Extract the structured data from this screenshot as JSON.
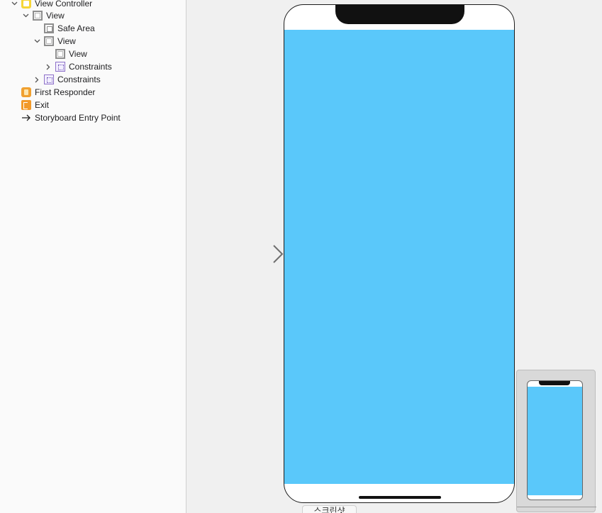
{
  "outline": {
    "items": [
      {
        "label": "View Controller",
        "icon": "view-controller-icon",
        "chevron": "down"
      },
      {
        "label": "View",
        "icon": "view-icon",
        "chevron": "down"
      },
      {
        "label": "Safe Area",
        "icon": "safe-area-icon",
        "chevron": ""
      },
      {
        "label": "View",
        "icon": "view-icon",
        "chevron": "down"
      },
      {
        "label": "View",
        "icon": "view-icon",
        "chevron": ""
      },
      {
        "label": "Constraints",
        "icon": "constraints-icon",
        "chevron": "right"
      },
      {
        "label": "Constraints",
        "icon": "constraints-icon",
        "chevron": "right"
      },
      {
        "label": "First Responder",
        "icon": "first-responder-icon",
        "chevron": ""
      },
      {
        "label": "Exit",
        "icon": "exit-icon",
        "chevron": ""
      },
      {
        "label": "Storyboard Entry Point",
        "icon": "entry-point-icon",
        "chevron": ""
      }
    ]
  },
  "canvas": {
    "scene_tab_label": "스크린샷",
    "screen_color": "#5ac8fa"
  }
}
